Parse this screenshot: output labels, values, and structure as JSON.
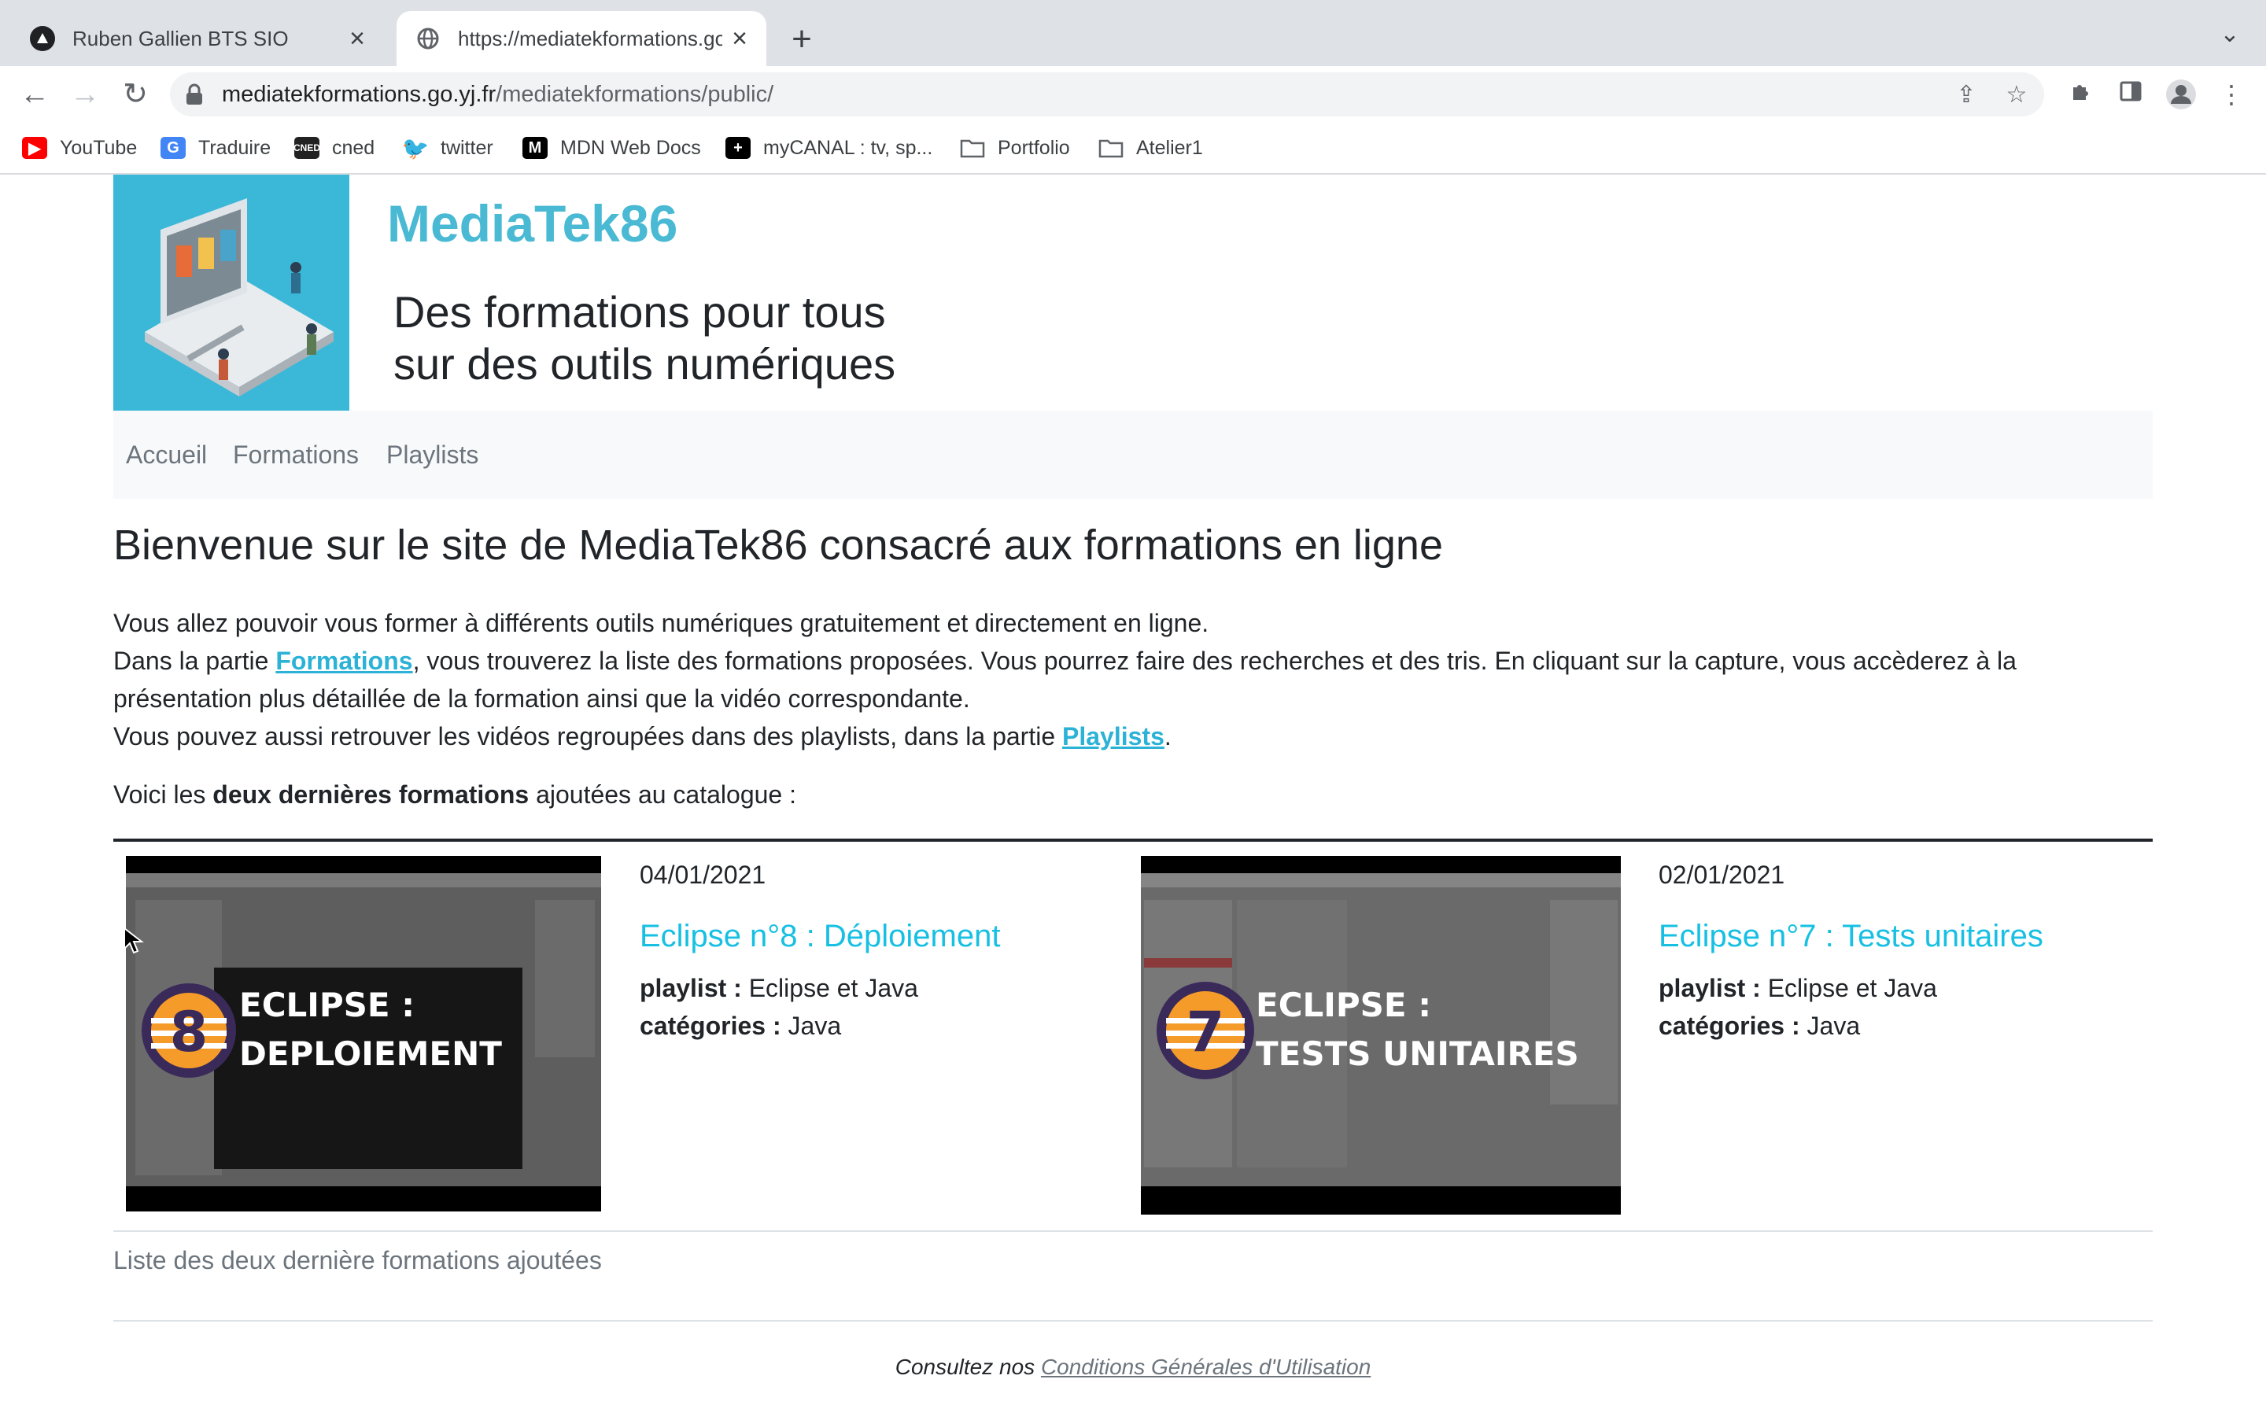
{
  "browser": {
    "tabs": [
      {
        "label": "Ruben Gallien BTS SIO",
        "icon": "app-logo-icon",
        "active": false
      },
      {
        "label": "https://mediatekformations.go.yj.fr/mediatekformations/public/",
        "icon": "globe-icon",
        "active": true
      }
    ],
    "new_tab_label": "+",
    "url_host": "mediatekformations.go.yj.fr",
    "url_path": "/mediatekformations/public/",
    "bookmarks": [
      {
        "label": "YouTube",
        "icon": "youtube-icon",
        "color": "#ff0000"
      },
      {
        "label": "Traduire",
        "icon": "google-translate-icon",
        "color": "#4285f4"
      },
      {
        "label": "cned",
        "icon": "cned-icon",
        "color": "#222222"
      },
      {
        "label": "twitter",
        "icon": "twitter-icon",
        "color": "#1d9bf0"
      },
      {
        "label": "MDN Web Docs",
        "icon": "mdn-icon",
        "color": "#000000"
      },
      {
        "label": "myCANAL : tv, sp...",
        "icon": "mycanal-icon",
        "color": "#000000"
      },
      {
        "label": "Portfolio",
        "icon": "folder-icon",
        "color": "#5f6368"
      },
      {
        "label": "Atelier1",
        "icon": "folder-icon",
        "color": "#5f6368"
      }
    ]
  },
  "site": {
    "title": "MediaTek86",
    "tagline_line1": "Des formations pour tous",
    "tagline_line2": "sur des outils numériques",
    "brand_color": "#4ab9d3",
    "link_color": "#17c0e3"
  },
  "nav": {
    "items": [
      {
        "label": "Accueil"
      },
      {
        "label": "Formations"
      },
      {
        "label": "Playlists"
      }
    ]
  },
  "main": {
    "heading": "Bienvenue sur le site de MediaTek86 consacré aux formations en ligne",
    "p1": "Vous allez pouvoir vous former à différents outils numériques gratuitement et directement en ligne.",
    "p2_before": "Dans la partie ",
    "p2_link": "Formations",
    "p2_after": ", vous trouverez la liste des formations proposées. Vous pourrez faire des recherches et des tris. En cliquant sur la capture, vous accèderez à la présentation plus détaillée de la formation ainsi que la vidéo correspondante.",
    "p3_before": "Vous pouvez aussi retrouver les vidéos regroupées dans des playlists, dans la partie ",
    "p3_link": "Playlists",
    "p3_after": ".",
    "latest_before": "Voici les ",
    "latest_bold": "deux dernières formations",
    "latest_after": " ajoutées au catalogue :",
    "formations": [
      {
        "date": "04/01/2021",
        "title": "Eclipse n°8 : Déploiement",
        "playlist_label": "playlist :",
        "playlist": "Eclipse et Java",
        "categories_label": "catégories :",
        "categories": "Java",
        "thumb_number": "8",
        "thumb_line1": "ECLIPSE :",
        "thumb_line2": "DEPLOIEMENT"
      },
      {
        "date": "02/01/2021",
        "title": "Eclipse n°7 : Tests unitaires",
        "playlist_label": "playlist :",
        "playlist": "Eclipse et Java",
        "categories_label": "catégories :",
        "categories": "Java",
        "thumb_number": "7",
        "thumb_line1": "ECLIPSE :",
        "thumb_line2": "TESTS UNITAIRES"
      }
    ],
    "caption": "Liste des deux dernière formations ajoutées"
  },
  "footer": {
    "text": "Consultez nos ",
    "link": "Conditions Générales d'Utilisation"
  }
}
